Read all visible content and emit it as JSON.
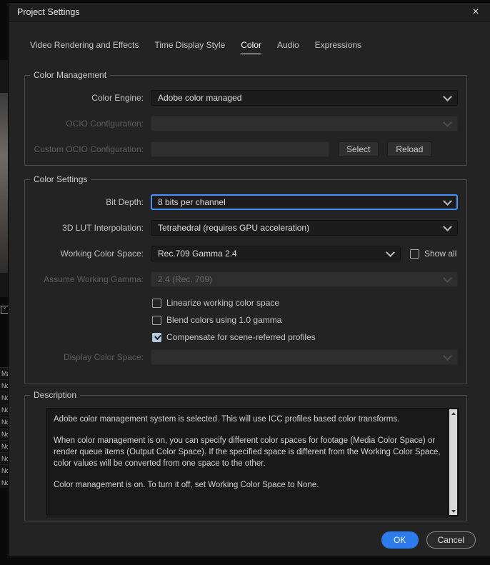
{
  "window": {
    "title": "Project Settings",
    "close_glyph": "×"
  },
  "tabs": [
    {
      "label": "Video Rendering and Effects",
      "active": false
    },
    {
      "label": "Time Display Style",
      "active": false
    },
    {
      "label": "Color",
      "active": true
    },
    {
      "label": "Audio",
      "active": false
    },
    {
      "label": "Expressions",
      "active": false
    }
  ],
  "color_management": {
    "legend": "Color Management",
    "color_engine_label": "Color Engine:",
    "color_engine_value": "Adobe color managed",
    "ocio_config_label": "OCIO Configuration:",
    "ocio_config_value": "",
    "custom_ocio_label": "Custom OCIO Configuration:",
    "custom_ocio_value": "",
    "select_button": "Select",
    "reload_button": "Reload"
  },
  "color_settings": {
    "legend": "Color Settings",
    "bit_depth_label": "Bit Depth:",
    "bit_depth_value": "8 bits per channel",
    "lut_label": "3D LUT Interpolation:",
    "lut_value": "Tetrahedral (requires GPU acceleration)",
    "working_space_label": "Working Color Space:",
    "working_space_value": "Rec.709 Gamma 2.4",
    "show_all_label": "Show all",
    "show_all_checked": false,
    "assume_gamma_label": "Assume Working Gamma:",
    "assume_gamma_value": "2.4 (Rec. 709)",
    "checkboxes": [
      {
        "label": "Linearize working color space",
        "checked": false
      },
      {
        "label": "Blend colors using 1.0 gamma",
        "checked": false
      },
      {
        "label": "Compensate for scene-referred profiles",
        "checked": true
      }
    ],
    "display_space_label": "Display Color Space:",
    "display_space_value": ""
  },
  "description": {
    "legend": "Description",
    "paragraphs": [
      "Adobe color management system is selected. This will use ICC profiles based color transforms.",
      "When color management is on, you can specify different color spaces for footage (Media Color Space) or render queue items (Output Color Space). If the specified space is different from the Working Color Space, color values will be converted from one space to the other.",
      "Color management is on. To turn it off, set Working Color Space to None."
    ]
  },
  "footer": {
    "ok": "OK",
    "cancel": "Cancel"
  },
  "background_fragments": [
    "Ma",
    "No",
    "No",
    "No",
    "No",
    "No",
    "No",
    "No",
    "No",
    "No"
  ],
  "colors": {
    "accent_blue": "#2d7bea",
    "focus_border": "#4792ff",
    "dialog_bg": "#232323"
  }
}
